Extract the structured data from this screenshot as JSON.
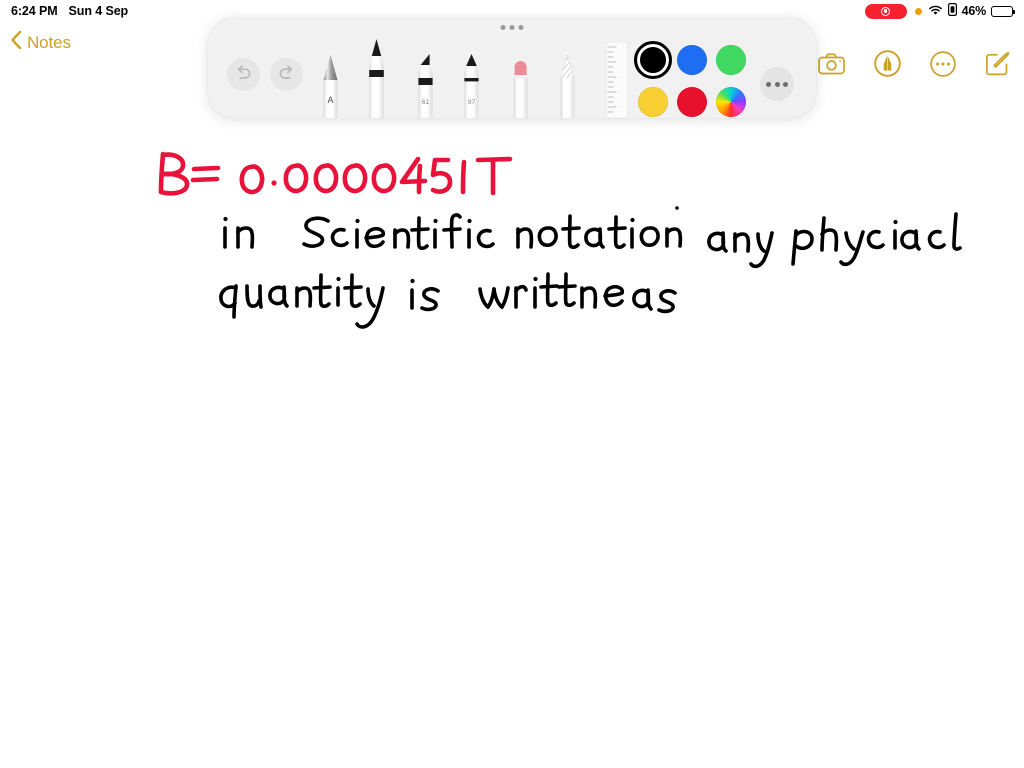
{
  "app": {
    "name": "Notes",
    "platform": "iPadOS"
  },
  "status_bar": {
    "time": "6:24 PM",
    "date": "Sun 4 Sep",
    "screen_recording_indicator": "recording-pill",
    "privacy_dot": "orange-dot",
    "wifi": "wifi-icon",
    "rotation_lock": "rotation-lock-icon",
    "battery_percent": "46%",
    "battery_level": 46
  },
  "nav": {
    "back_label": "Notes",
    "back_icon": "chevron-left-icon",
    "actions": [
      {
        "name": "camera",
        "icon": "camera-icon"
      },
      {
        "name": "markup",
        "icon": "markup-pen-icon",
        "active": true
      },
      {
        "name": "more",
        "icon": "ellipsis-circle-icon"
      },
      {
        "name": "compose",
        "icon": "compose-icon"
      }
    ],
    "accent_color": "#c9a227"
  },
  "markup_toolbar": {
    "handle": "drag-handle",
    "undo": {
      "label": "Undo",
      "icon": "undo-arrow-icon",
      "enabled": false
    },
    "redo": {
      "label": "Redo",
      "icon": "redo-arrow-icon",
      "enabled": false
    },
    "tools": [
      {
        "name": "fountain-pen",
        "label": "A",
        "selected": false
      },
      {
        "name": "pen",
        "label": "",
        "selected": true
      },
      {
        "name": "highlighter",
        "label": "61",
        "selected": false
      },
      {
        "name": "marker",
        "label": "97",
        "selected": false
      },
      {
        "name": "eraser",
        "label": "",
        "selected": false
      },
      {
        "name": "lasso",
        "label": "",
        "selected": false
      },
      {
        "name": "ruler",
        "label": "",
        "selected": false
      }
    ],
    "colors": [
      {
        "name": "black",
        "hex": "#000000",
        "selected": true
      },
      {
        "name": "blue",
        "hex": "#1d6ef3",
        "selected": false
      },
      {
        "name": "green",
        "hex": "#40d860",
        "selected": false
      },
      {
        "name": "yellow",
        "hex": "#f7cf33",
        "selected": false
      },
      {
        "name": "red",
        "hex": "#e8112d",
        "selected": false
      },
      {
        "name": "color-picker",
        "hex": "rainbow",
        "selected": false
      }
    ],
    "more_colors_label": "More Colors"
  },
  "note": {
    "lines": [
      {
        "id": "line1",
        "text": "B=  0.0000451 T",
        "color": "#e8123a",
        "handwritten": true
      },
      {
        "id": "line2",
        "text": "in  Scientific  notation  any  physical",
        "color": "#000000",
        "handwritten": true
      },
      {
        "id": "line3",
        "text": "quantity  is  written as",
        "color": "#000000",
        "handwritten": true
      }
    ],
    "ink_red": "#e8123a",
    "ink_black": "#0a0a0a"
  }
}
